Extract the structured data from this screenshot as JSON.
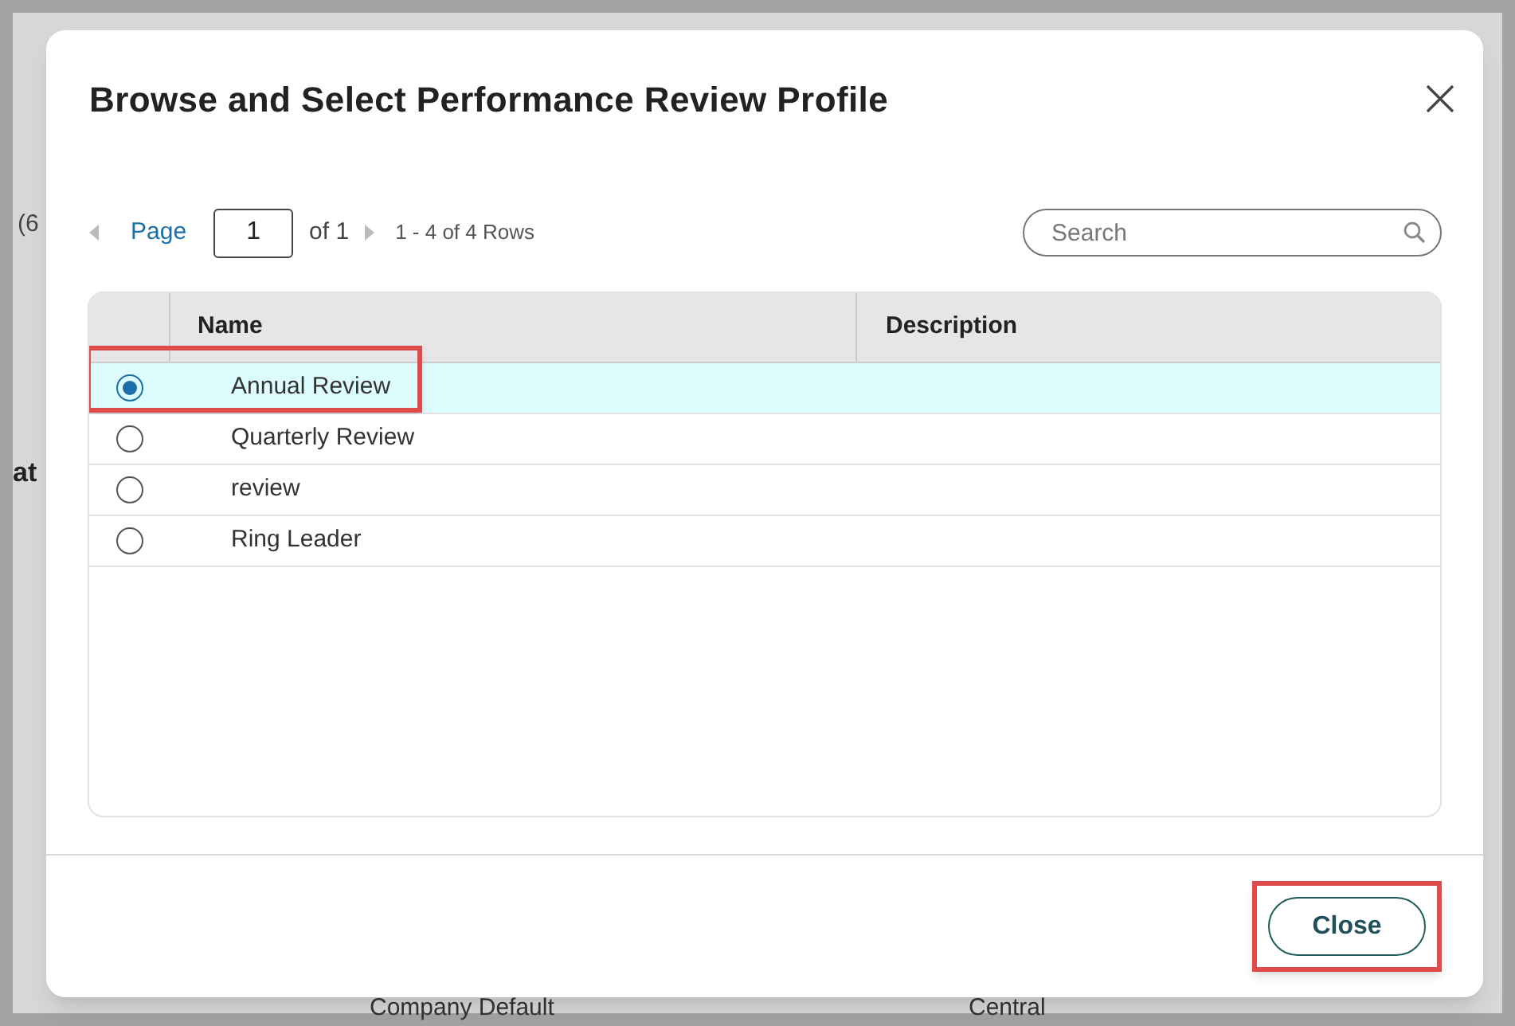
{
  "background": {
    "texts": [
      "(6",
      "at",
      "Company Default",
      "Central"
    ]
  },
  "dialog": {
    "title": "Browse and Select Performance Review Profile"
  },
  "pager": {
    "label": "Page",
    "page": "1",
    "of": "of 1",
    "rows": "1 - 4 of 4 Rows"
  },
  "search": {
    "placeholder": "Search"
  },
  "table": {
    "columns": [
      "Name",
      "Description"
    ],
    "rows": [
      {
        "name": "Annual Review",
        "description": "",
        "selected": true,
        "highlighted": true
      },
      {
        "name": "Quarterly Review",
        "selected": false,
        "highlighted": false
      },
      {
        "name": "review",
        "selected": false,
        "highlighted": false
      },
      {
        "name": "Ring Leader",
        "selected": false,
        "highlighted": false
      }
    ]
  },
  "footer": {
    "close_button": {
      "label": "Close",
      "highlighted": true
    }
  }
}
